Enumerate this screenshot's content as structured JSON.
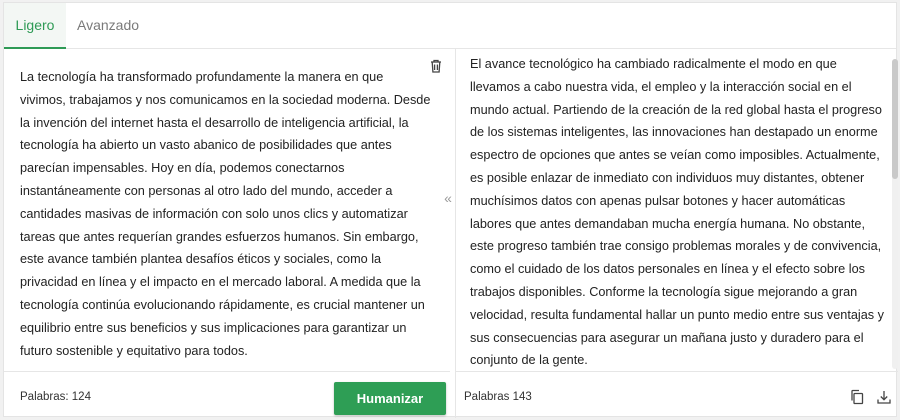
{
  "tabs": [
    {
      "label": "Ligero",
      "active": true
    },
    {
      "label": "Avanzado",
      "active": false
    }
  ],
  "input": {
    "text": "La tecnología ha transformado profundamente la manera en que vivimos, trabajamos y nos comunicamos en la sociedad moderna. Desde la invención del internet hasta el desarrollo de inteligencia artificial, la tecnología ha abierto un vasto abanico de posibilidades que antes parecían impensables. Hoy en día, podemos conectarnos instantáneamente con personas al otro lado del mundo, acceder a cantidades masivas de información con solo unos clics y automatizar tareas que antes requerían grandes esfuerzos humanos. Sin embargo, este avance también plantea desafíos éticos y sociales, como la privacidad en línea y el impacto en el mercado laboral. A medida que la tecnología continúa evolucionando rápidamente, es crucial mantener un equilibrio entre sus beneficios y sus implicaciones para garantizar un futuro sostenible y equitativo para todos.",
    "word_count": "Palabras: 124",
    "delete_icon": "trash-icon"
  },
  "output": {
    "text": "El avance tecnológico ha cambiado radicalmente el modo en que llevamos a cabo nuestra vida, el empleo y la interacción social en el mundo actual. Partiendo de la creación de la red global hasta el progreso de los sistemas inteligentes, las innovaciones han destapado un enorme espectro de opciones que antes se veían como imposibles. Actualmente, es posible enlazar de inmediato con individuos muy distantes, obtener muchísimos datos con apenas pulsar botones y hacer automáticas labores que antes demandaban mucha energía humana. No obstante, este progreso también trae consigo problemas morales y de convivencia, como el cuidado de los datos personales en línea y el efecto sobre los trabajos disponibles. Conforme la tecnología sigue mejorando a gran velocidad, resulta fundamental hallar un punto medio entre sus ventajas y sus consecuencias para asegurar un mañana justo y duradero para el conjunto de la gente.",
    "word_count": "Palabras 143",
    "copy_icon": "copy-icon",
    "download_icon": "download-icon"
  },
  "actions": {
    "humanize_label": "Humanizar",
    "collapse_glyph": "«"
  },
  "colors": {
    "accent": "#2e9e55",
    "tab_active_text": "#2e9a55"
  }
}
